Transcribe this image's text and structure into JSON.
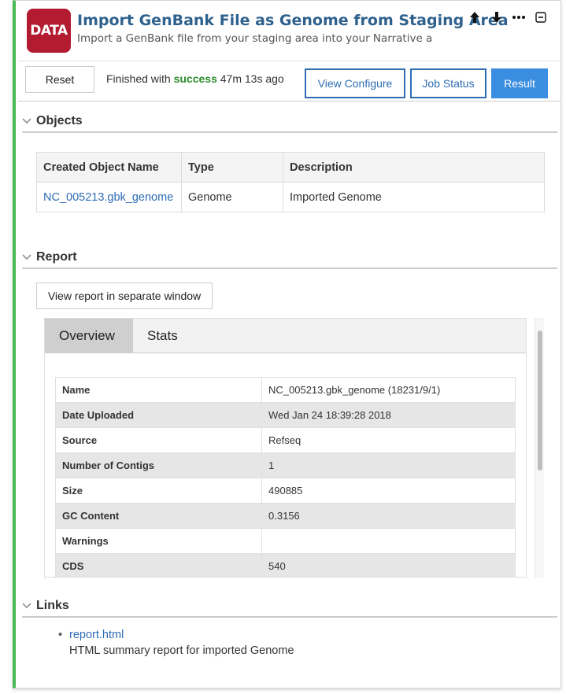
{
  "header": {
    "logo_text": "DATA",
    "title": "Import GenBank File as Genome from Staging Area",
    "subtitle": "Import a GenBank file from your staging area into your Narrative as a"
  },
  "toolbar": {
    "reset_label": "Reset",
    "status_prefix": "Finished with",
    "status_word": "success",
    "status_suffix": "47m 13s ago",
    "view_configure_label": "View Configure",
    "job_status_label": "Job Status",
    "result_label": "Result"
  },
  "objects": {
    "section_title": "Objects",
    "columns": [
      "Created Object Name",
      "Type",
      "Description"
    ],
    "rows": [
      {
        "name": "NC_005213.gbk_genome",
        "type": "Genome",
        "description": "Imported Genome"
      }
    ]
  },
  "report": {
    "section_title": "Report",
    "view_window_label": "View report in separate window",
    "tabs": [
      "Overview",
      "Stats"
    ],
    "rows": [
      {
        "key": "Name",
        "value": "NC_005213.gbk_genome (18231/9/1)"
      },
      {
        "key": "Date Uploaded",
        "value": "Wed Jan 24 18:39:28 2018"
      },
      {
        "key": "Source",
        "value": "Refseq"
      },
      {
        "key": "Number of Contigs",
        "value": "1"
      },
      {
        "key": "Size",
        "value": "490885"
      },
      {
        "key": "GC Content",
        "value": "0.3156"
      },
      {
        "key": "Warnings",
        "value": ""
      },
      {
        "key": "CDS",
        "value": "540"
      }
    ]
  },
  "links": {
    "section_title": "Links",
    "items": [
      {
        "label": "report.html",
        "description": "HTML summary report for imported Genome"
      }
    ]
  },
  "colors": {
    "accent": "#2e6db4",
    "success": "#2e8b2e",
    "logo_bg": "#b31b31",
    "cell_border": "#4bb856"
  }
}
